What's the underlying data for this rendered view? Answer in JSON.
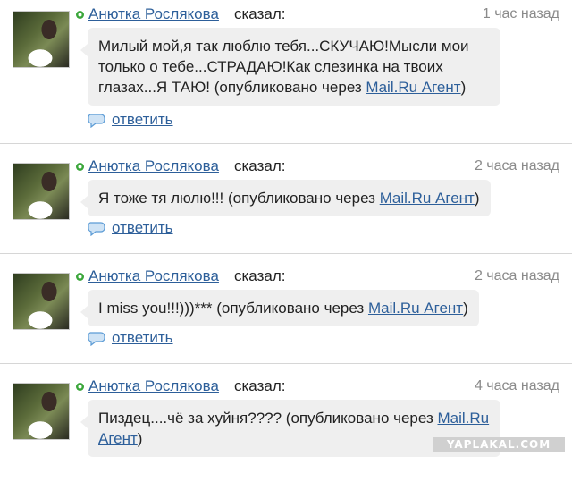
{
  "posts": [
    {
      "author": "Анютка Рослякова",
      "said": "сказал:",
      "time": "1 час назад",
      "message": "Милый мой,я так люблю тебя...СКУЧАЮ!Мысли мои только о тебе...СТРАДАЮ!Как слезинка на твоих глазах...Я ТАЮ! (опубликовано через ",
      "agent": "Mail.Ru Агент",
      "close": ")",
      "reply": "ответить"
    },
    {
      "author": "Анютка Рослякова",
      "said": "сказал:",
      "time": "2 часа назад",
      "message": "Я тоже тя люлю!!! (опубликовано через ",
      "agent": "Mail.Ru Агент",
      "close": ")",
      "reply": "ответить"
    },
    {
      "author": "Анютка Рослякова",
      "said": "сказал:",
      "time": "2 часа назад",
      "message": "I miss you!!!)))*** (опубликовано через ",
      "agent": "Mail.Ru Агент",
      "close": ")",
      "reply": "ответить"
    },
    {
      "author": "Анютка Рослякова",
      "said": "сказал:",
      "time": "4 часа назад",
      "message": "Пиздец....чё за хуйня???? (опубликовано через ",
      "agent": "Mail.Ru Агент",
      "close": ")"
    }
  ],
  "watermark": "YAPLAKAL.COM",
  "icons": {
    "status": "online-status-icon",
    "reply": "speech-bubble-icon"
  },
  "colors": {
    "link": "#2d5f9a",
    "bubble": "#efefef",
    "time": "#8a8a8a",
    "online": "#3aa63a"
  }
}
